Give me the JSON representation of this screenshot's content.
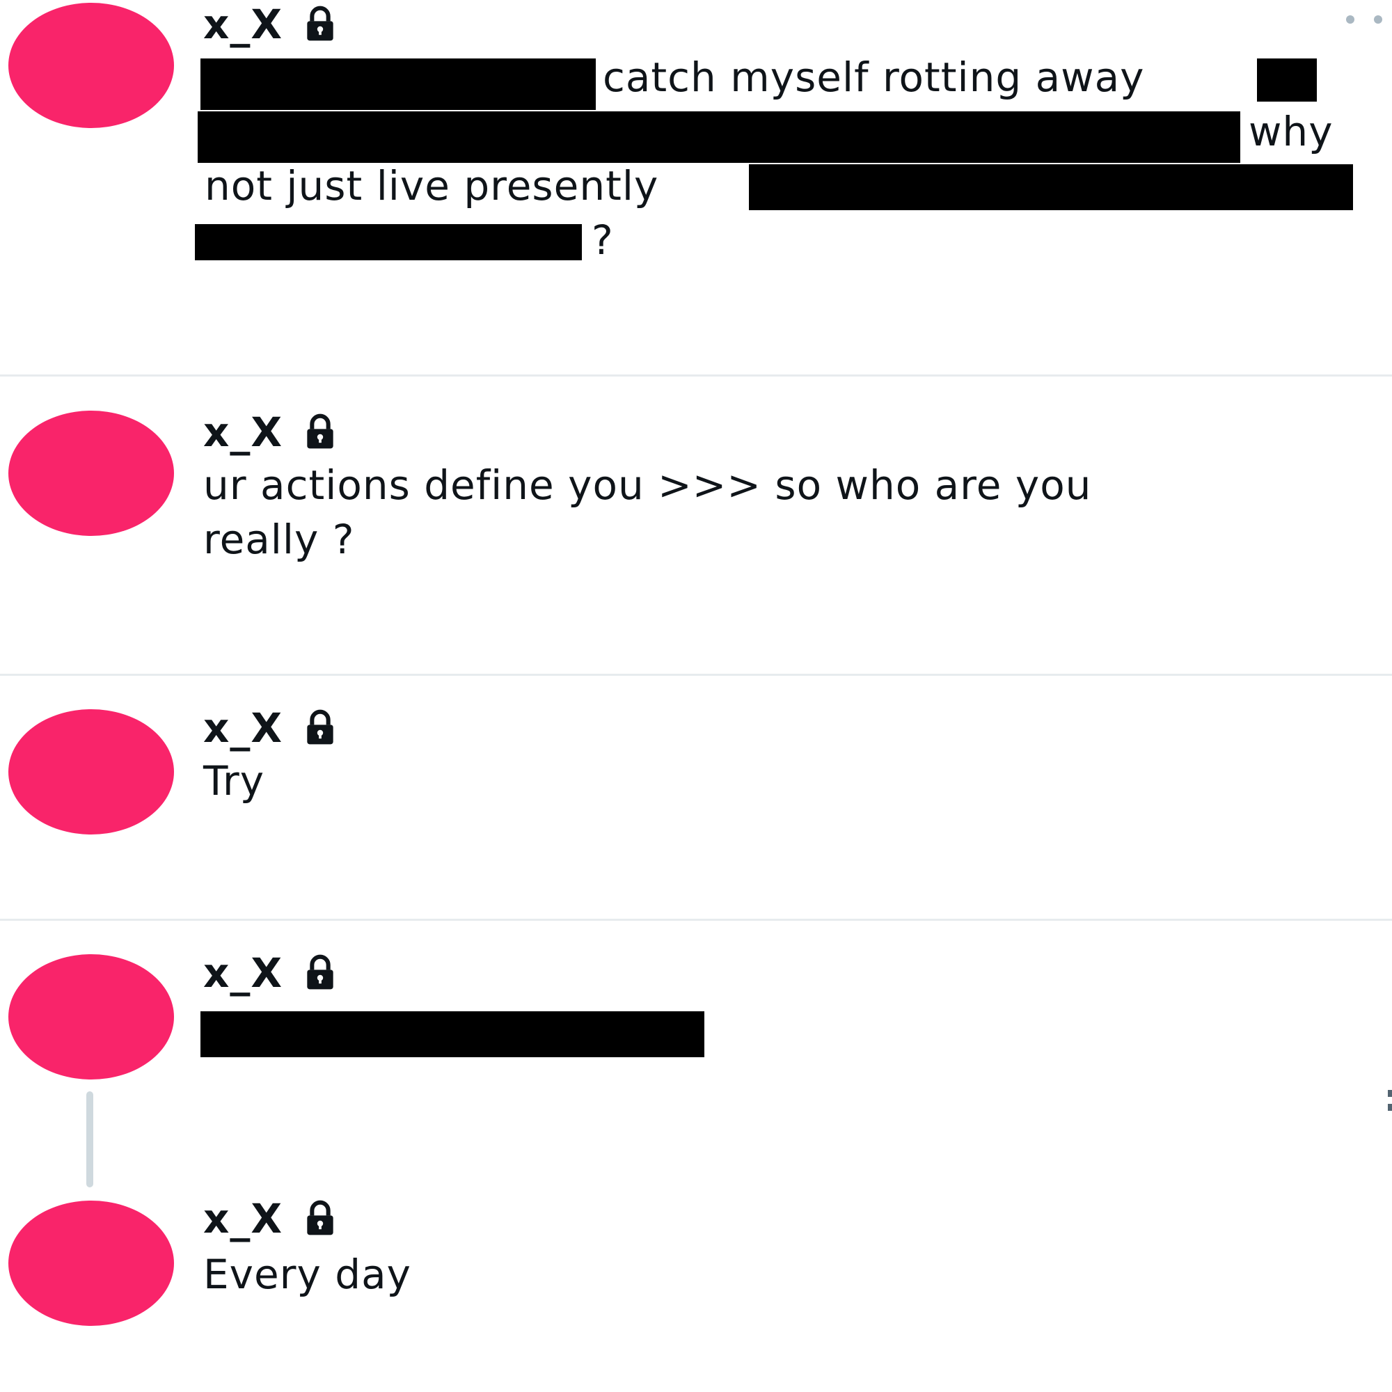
{
  "posts": [
    {
      "username": "x_X",
      "locked": true,
      "lines": [
        "catch myself rotting away",
        "why",
        "not just live presently",
        "?"
      ]
    },
    {
      "username": "x_X",
      "locked": true,
      "lines": [
        "ur actions define you >>> so who are you",
        "really ?"
      ]
    },
    {
      "username": "x_X",
      "locked": true,
      "lines": [
        "Try"
      ]
    },
    {
      "username": "x_X",
      "locked": true,
      "lines": []
    },
    {
      "username": "x_X",
      "locked": true,
      "lines": [
        "Every day"
      ]
    }
  ],
  "icons": {
    "lock": "lock-icon",
    "more": "more-options-icon"
  },
  "colors": {
    "avatar": "#f9246a",
    "text": "#0f1419",
    "divider": "#e7ebee",
    "thread_line": "#cfd9de",
    "redaction": "#000000"
  }
}
